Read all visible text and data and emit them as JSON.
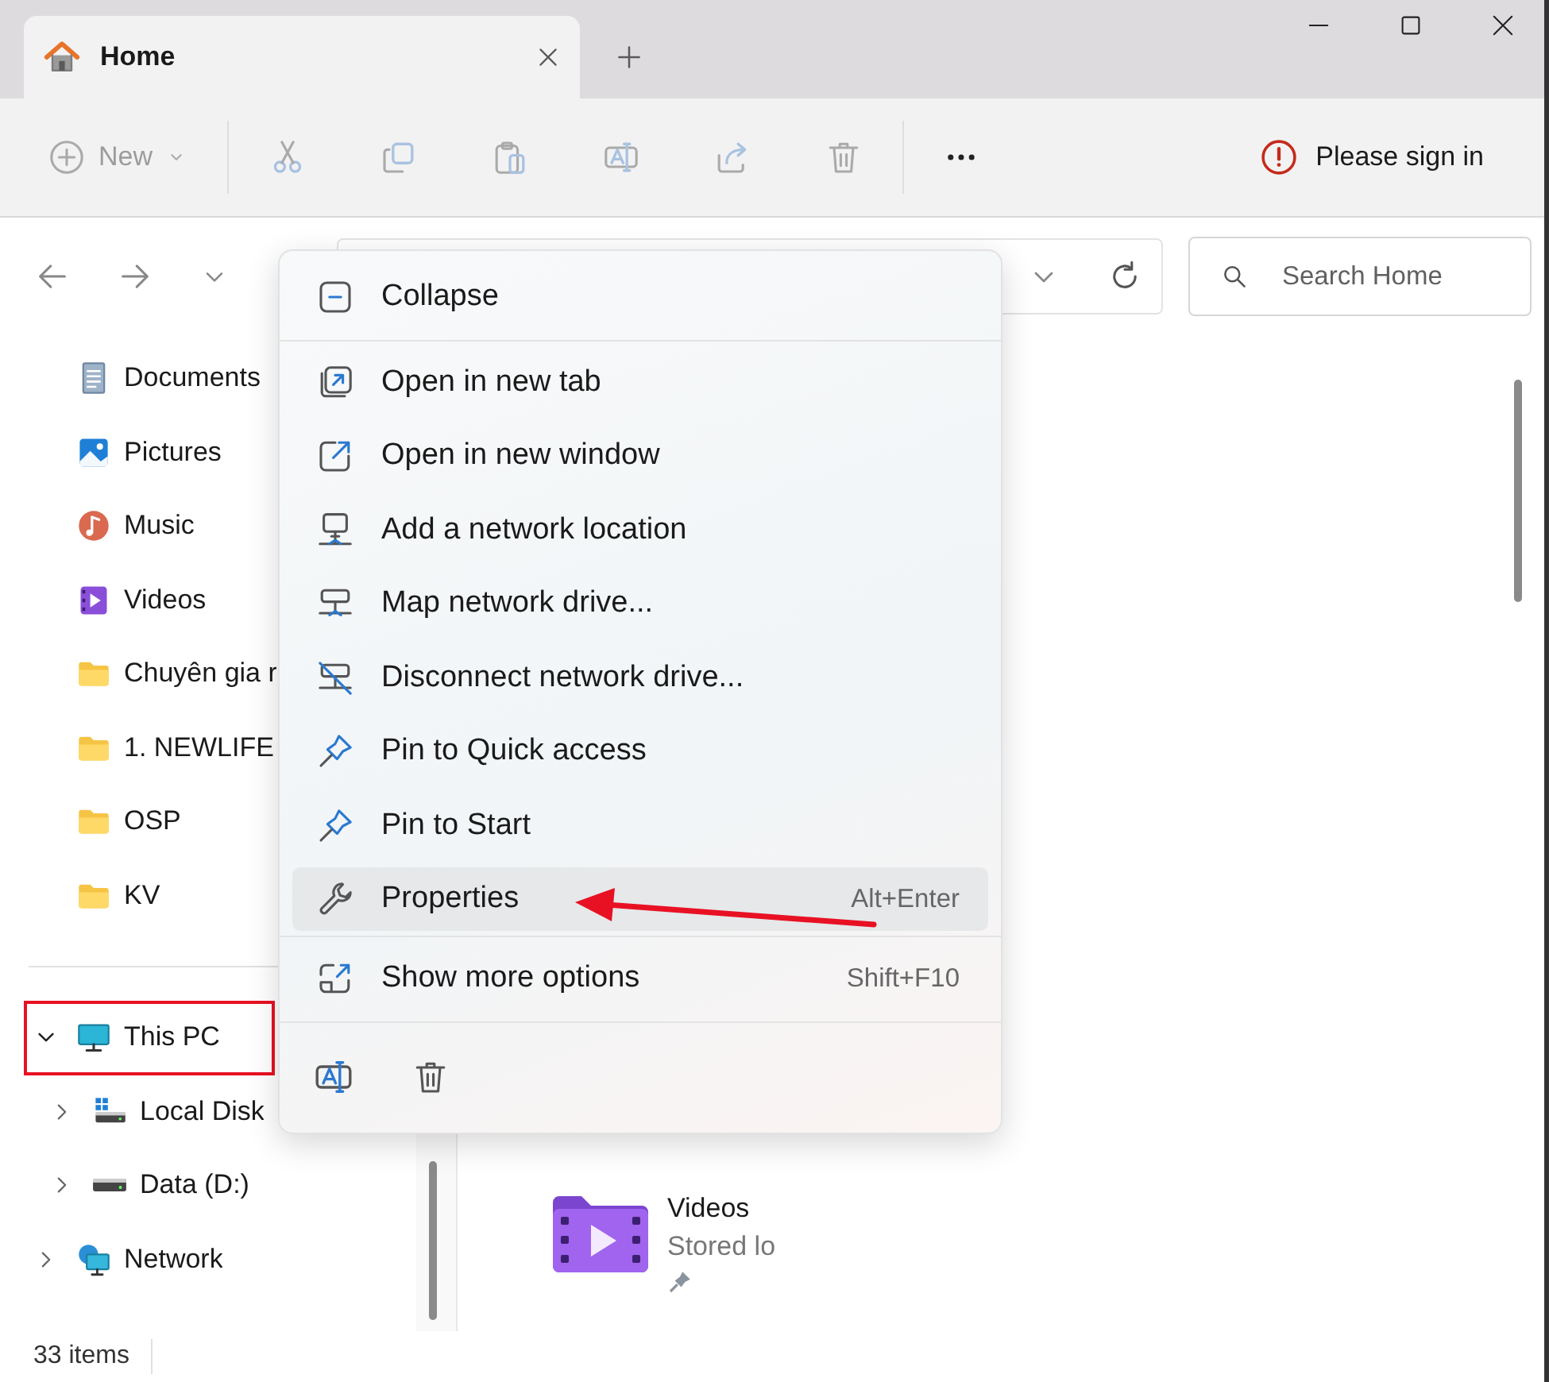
{
  "tabs": [
    {
      "label": "Home",
      "selected": true
    }
  ],
  "toolbar": {
    "new_label": "New",
    "sign_in": "Please sign in"
  },
  "search": {
    "placeholder": "Search Home"
  },
  "sidebar": {
    "sections": [
      [
        {
          "label": "Documents",
          "kind": "documents"
        },
        {
          "label": "Pictures",
          "kind": "pictures"
        },
        {
          "label": "Music",
          "kind": "music"
        },
        {
          "label": "Videos",
          "kind": "videos"
        },
        {
          "label": "Chuyên gia r",
          "kind": "folder"
        },
        {
          "label": "1. NEWLIFE",
          "kind": "folder"
        },
        {
          "label": "OSP",
          "kind": "folder"
        },
        {
          "label": "KV",
          "kind": "folder"
        }
      ],
      [
        {
          "label": "This PC",
          "kind": "pc",
          "expanded": true,
          "annotated": true,
          "children": [
            {
              "label": "Local Disk",
              "kind": "system-drive",
              "expanded": false,
              "annotated": false
            },
            {
              "label": "Data (D:)",
              "kind": "drive",
              "expanded": false,
              "annotated": false
            }
          ]
        },
        {
          "label": "Network",
          "kind": "network",
          "expanded": false,
          "annotated": false
        }
      ]
    ]
  },
  "content": {
    "items": [
      {
        "name": "Videos",
        "detail": "Stored lo",
        "pinned": true
      }
    ]
  },
  "status_bar": {
    "count": "33 items"
  },
  "context_menu": {
    "groups": [
      [
        {
          "label": "Collapse",
          "kind": "collapse",
          "selected": false,
          "annotated": false
        }
      ],
      [
        {
          "label": "Open in new tab",
          "kind": "new-tab",
          "selected": false,
          "annotated": false
        },
        {
          "label": "Open in new window",
          "kind": "new-window",
          "selected": false,
          "annotated": false
        },
        {
          "label": "Add a network location",
          "kind": "net-location",
          "selected": false,
          "annotated": false
        },
        {
          "label": "Map network drive...",
          "kind": "map-drive",
          "selected": false,
          "annotated": false
        },
        {
          "label": "Disconnect network drive...",
          "kind": "disconnect",
          "selected": false,
          "annotated": false
        },
        {
          "label": "Pin to Quick access",
          "kind": "pin",
          "selected": false,
          "annotated": false
        },
        {
          "label": "Pin to Start",
          "kind": "pin",
          "selected": false,
          "annotated": false
        },
        {
          "label": "Properties",
          "kind": "properties",
          "shortcut": "Alt+Enter",
          "selected": true,
          "annotated": true
        }
      ],
      [
        {
          "label": "Show more options",
          "kind": "more-options",
          "shortcut": "Shift+F10",
          "selected": false,
          "annotated": false
        }
      ]
    ]
  }
}
